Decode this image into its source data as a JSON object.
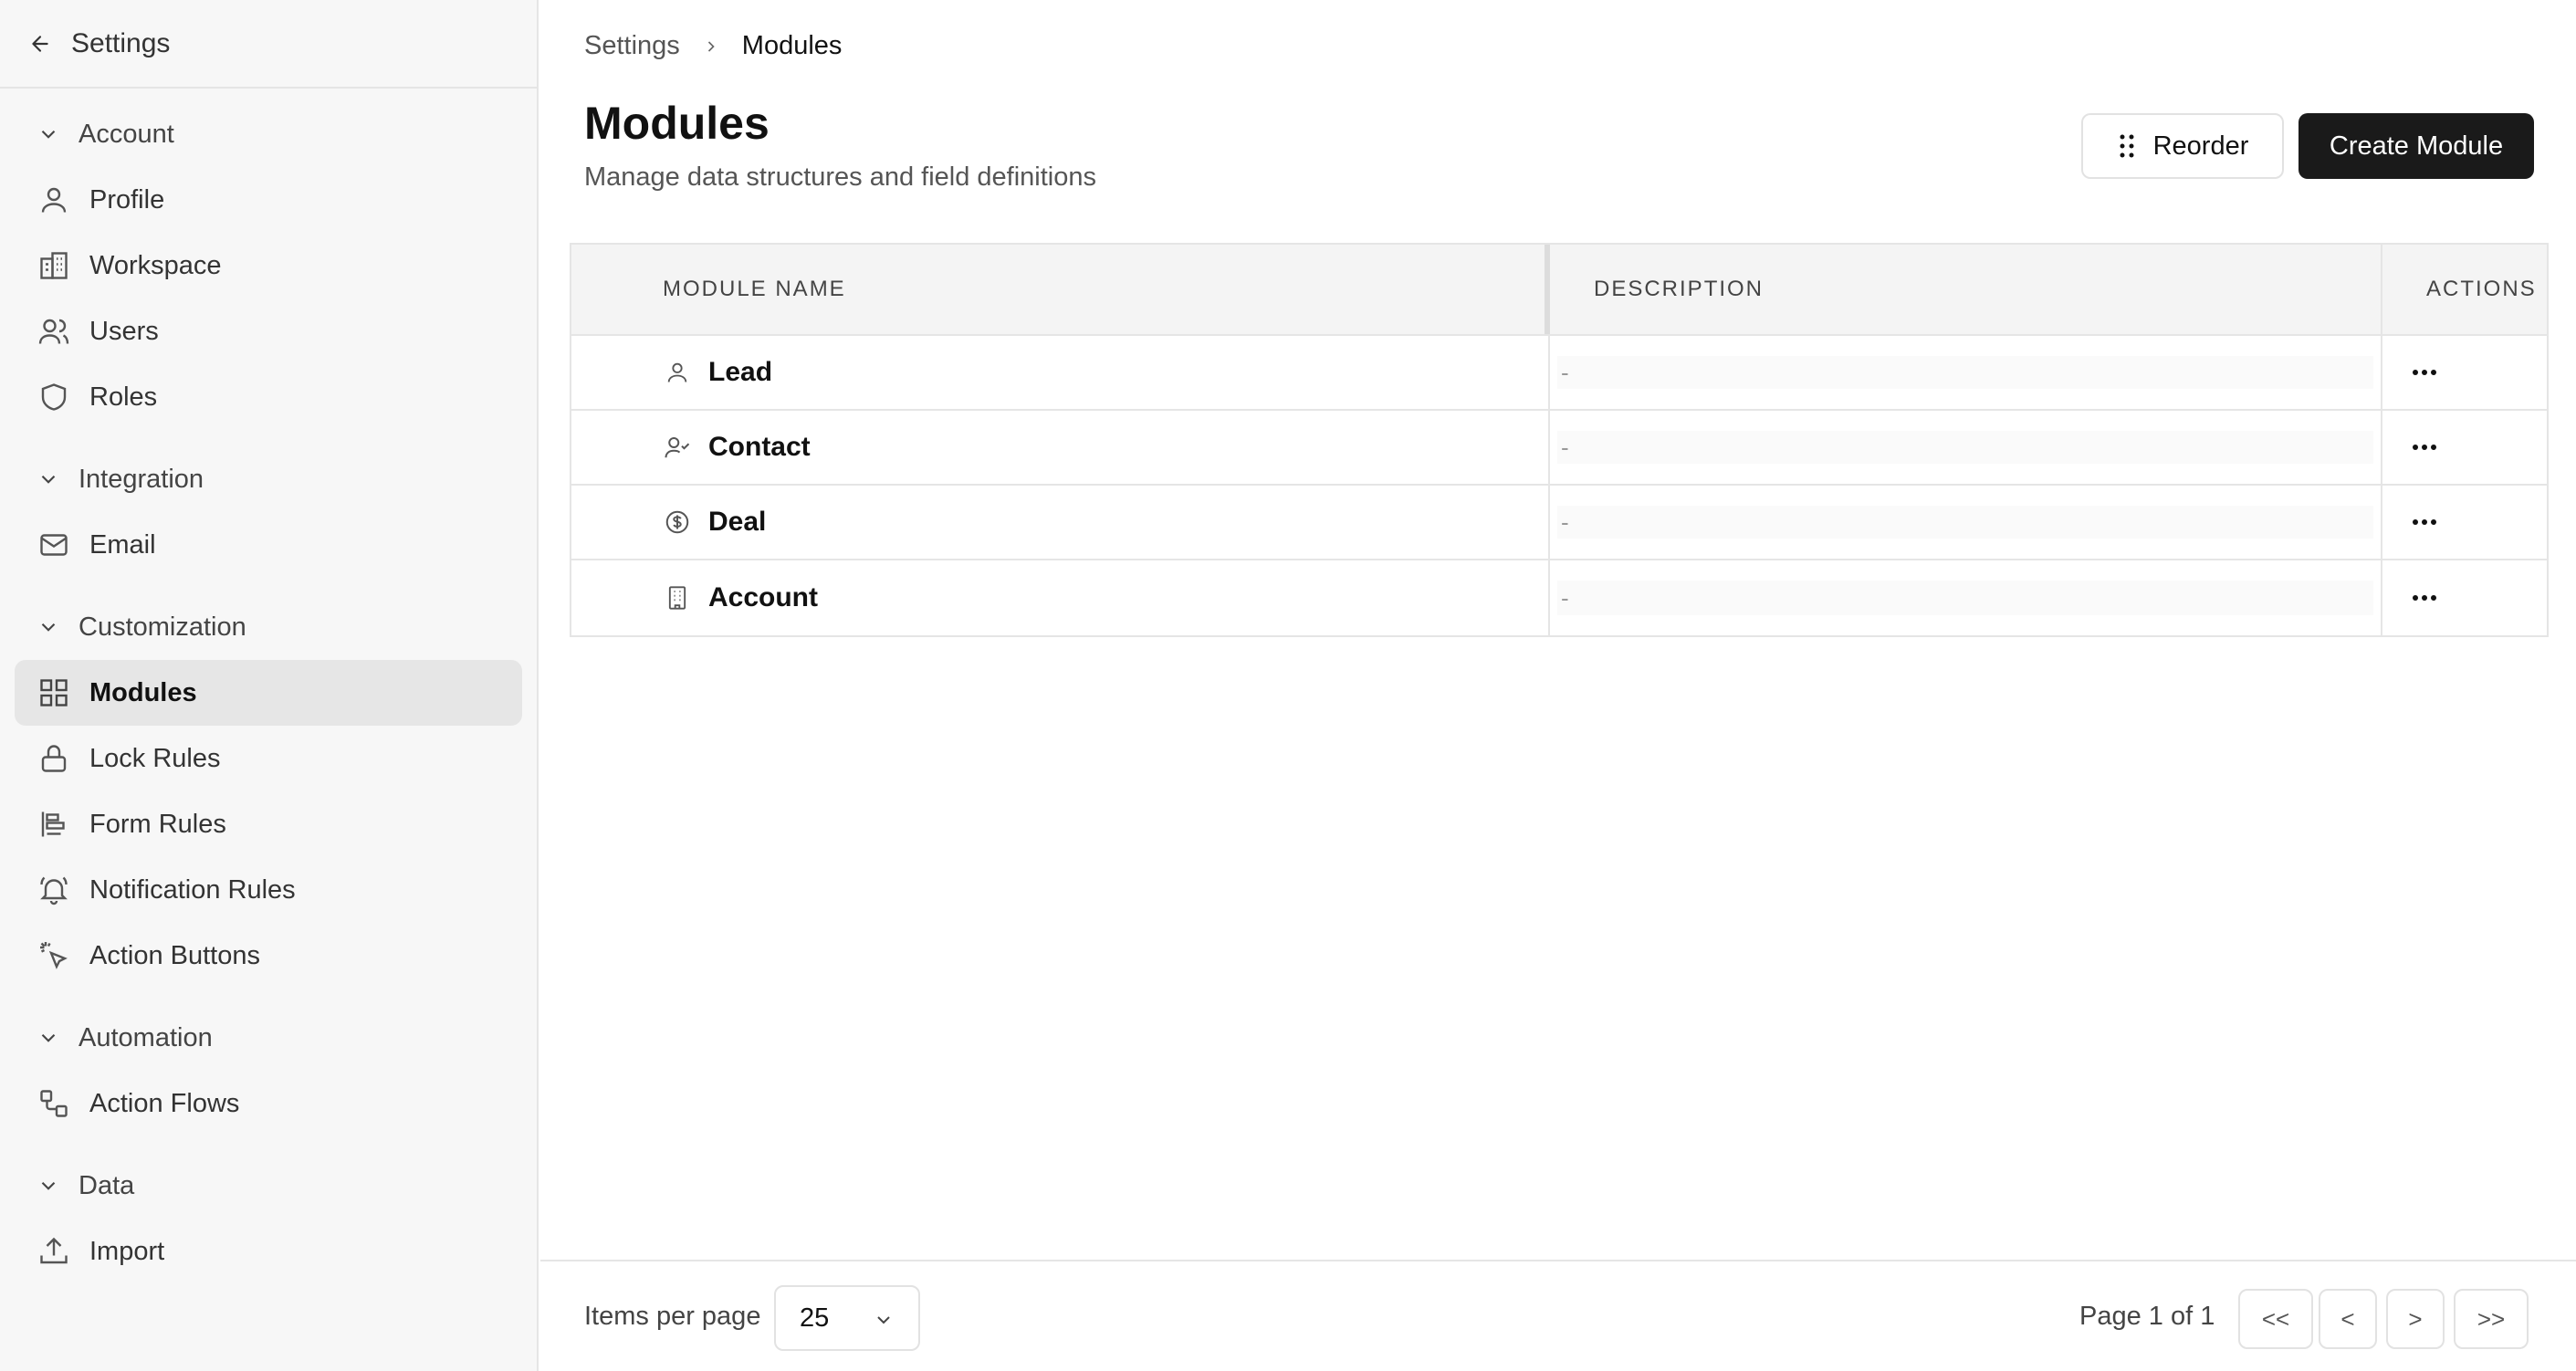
{
  "sidebar": {
    "header_title": "Settings",
    "sections": {
      "account": {
        "label": "Account",
        "items": [
          "Profile",
          "Workspace",
          "Users",
          "Roles"
        ]
      },
      "integration": {
        "label": "Integration",
        "items": [
          "Email"
        ]
      },
      "customization": {
        "label": "Customization",
        "items": [
          "Modules",
          "Lock Rules",
          "Form Rules",
          "Notification Rules",
          "Action Buttons"
        ]
      },
      "automation": {
        "label": "Automation",
        "items": [
          "Action Flows"
        ]
      },
      "data": {
        "label": "Data",
        "items": [
          "Import"
        ]
      }
    },
    "active_item": "Modules"
  },
  "breadcrumb": {
    "root": "Settings",
    "current": "Modules"
  },
  "header": {
    "title": "Modules",
    "subtitle": "Manage data structures and field definitions",
    "reorder_label": "Reorder",
    "create_label": "Create Module"
  },
  "table": {
    "columns": [
      "MODULE NAME",
      "DESCRIPTION",
      "ACTIONS"
    ],
    "rows": [
      {
        "name": "Lead",
        "icon": "user-icon",
        "description": "-"
      },
      {
        "name": "Contact",
        "icon": "user-check-icon",
        "description": "-"
      },
      {
        "name": "Deal",
        "icon": "dollar-circle-icon",
        "description": "-"
      },
      {
        "name": "Account",
        "icon": "building-icon",
        "description": "-"
      }
    ]
  },
  "footer": {
    "items_per_page_label": "Items per page",
    "items_per_page_value": "25",
    "page_info": "Page 1 of 1",
    "first": "<<",
    "prev": "<",
    "next": ">",
    "last": ">>"
  },
  "colors": {
    "primary_button": "#1a1a1a",
    "active_nav_bg": "#e6e6e6",
    "sidebar_bg": "#f7f7f7"
  }
}
